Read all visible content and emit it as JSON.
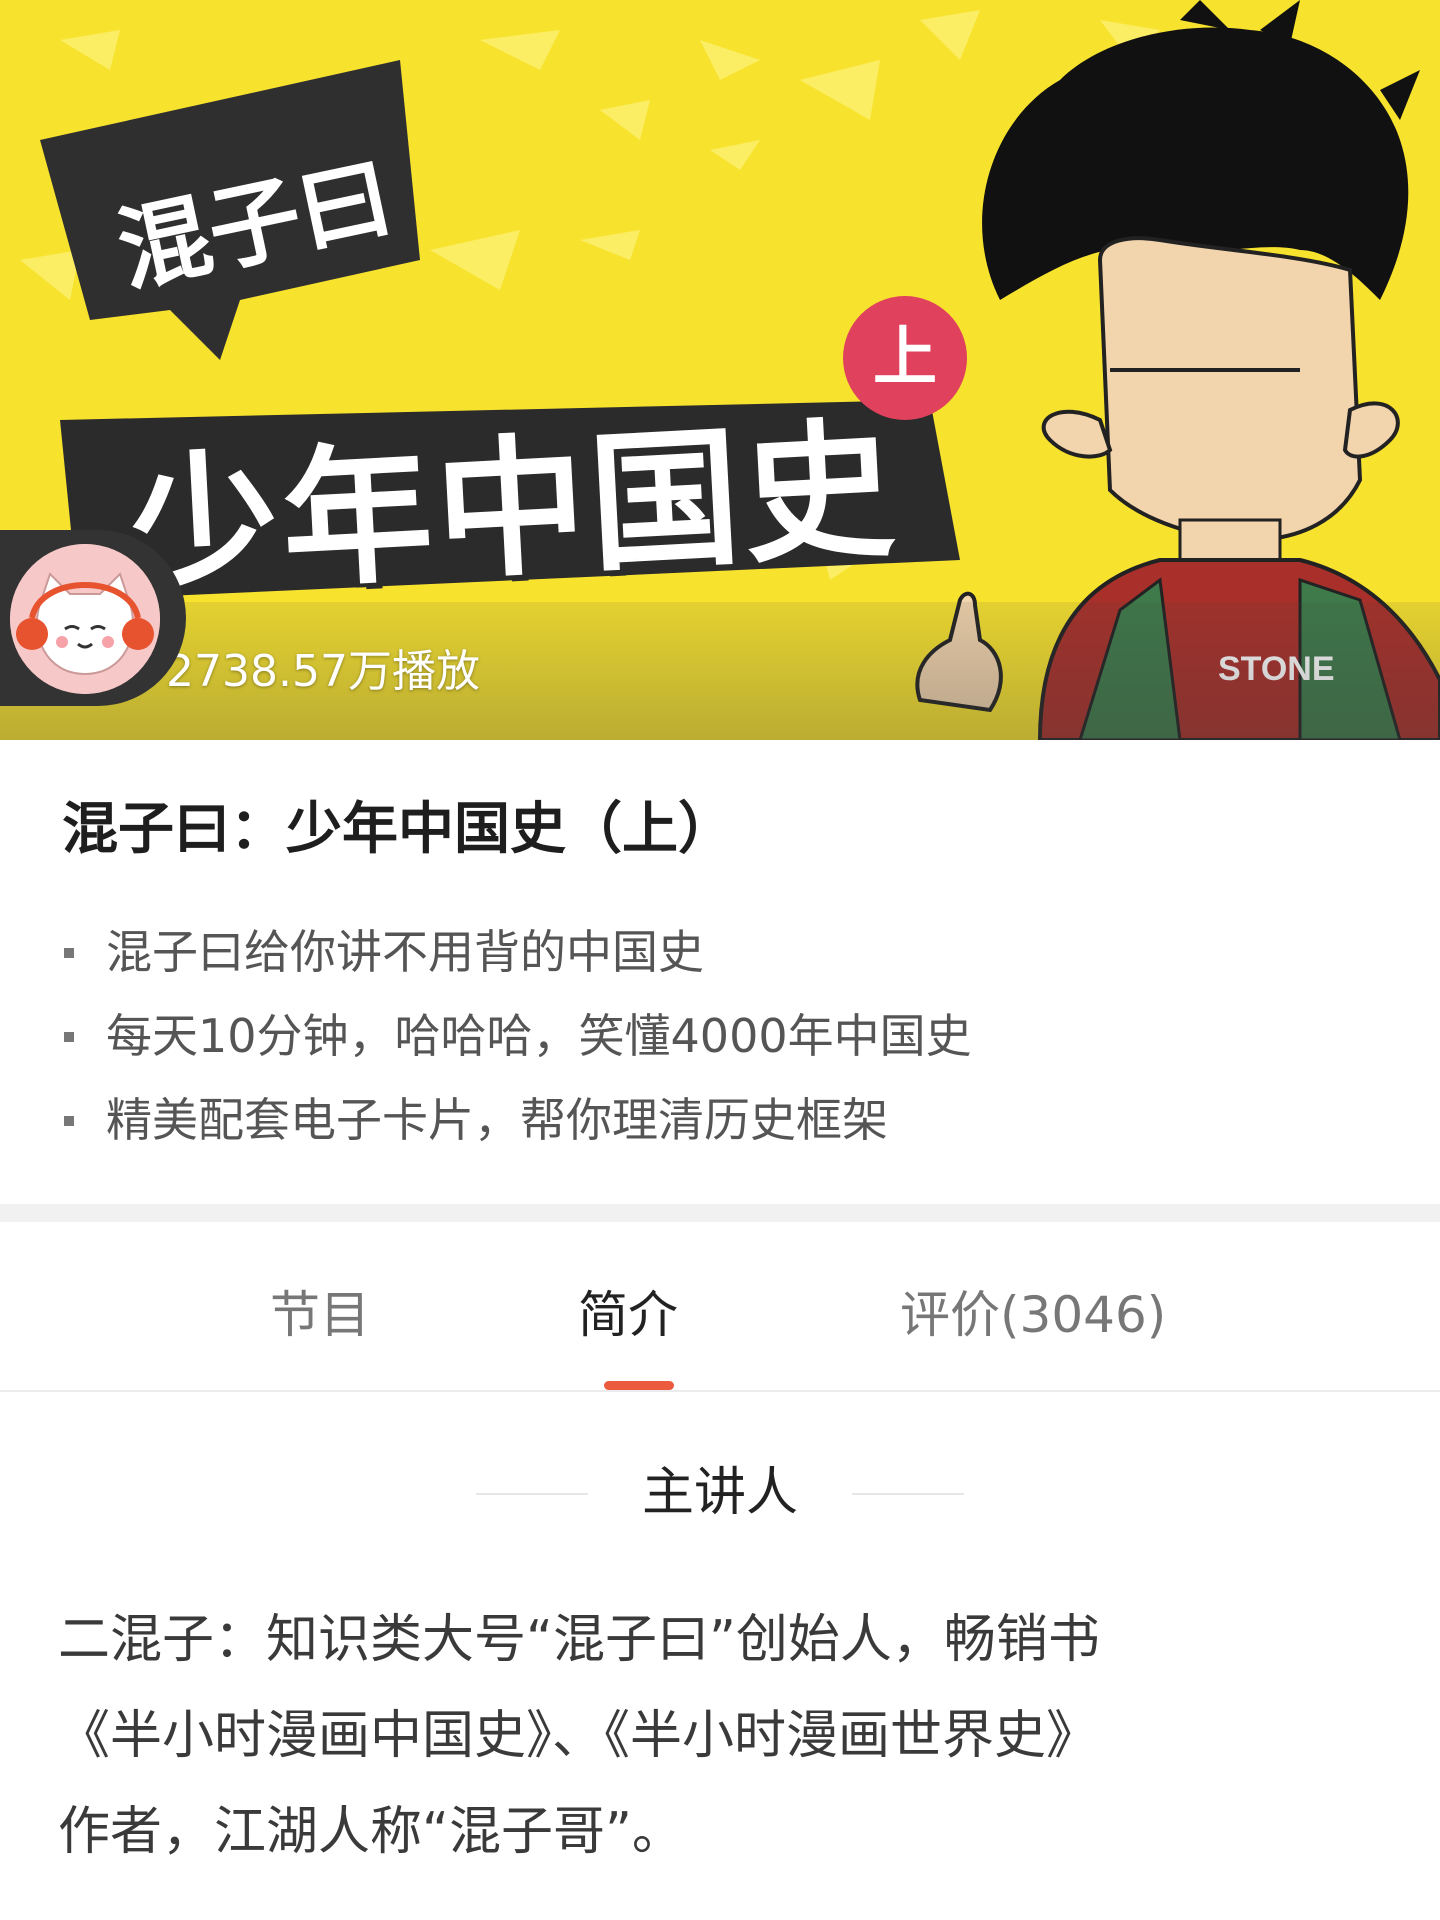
{
  "banner": {
    "brand_tag": "混子曰",
    "cover_title": "少年中国史",
    "part_badge": "上",
    "play_count": "2738.57万播放",
    "hoodie_text": "STONE",
    "background_color": "#f7e22e",
    "badge_color": "#e0415d"
  },
  "course": {
    "title": "混子曰：少年中国史（上）",
    "features": [
      "混子曰给你讲不用背的中国史",
      "每天10分钟，哈哈哈，笑懂4000年中国史",
      "精美配套电子卡片，帮你理清历史框架"
    ]
  },
  "tabs": {
    "items": [
      "节目",
      "简介",
      "评价(3046)"
    ],
    "active": "简介",
    "accent_color": "#ec5b3d"
  },
  "intro": {
    "section_title": "主讲人",
    "bio_lines": [
      "二混子：知识类大号“混子曰”创始人，畅销书",
      "《半小时漫画中国史》、《半小时漫画世界史》",
      "作者，江湖人称“混子哥”。"
    ]
  }
}
